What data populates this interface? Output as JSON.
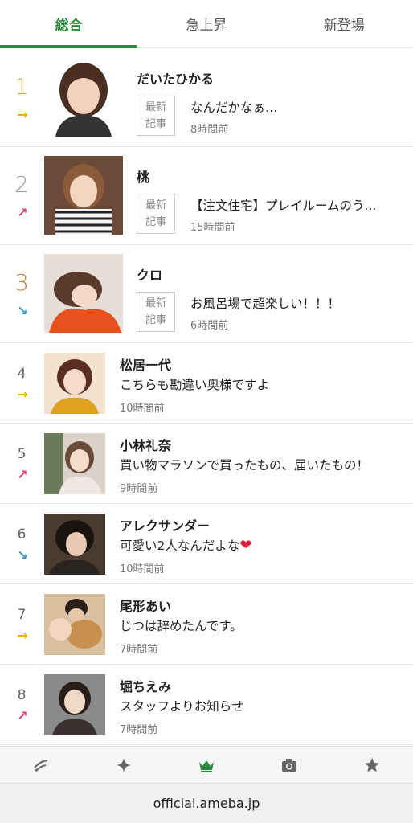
{
  "tabs": [
    {
      "label": "総合",
      "active": true
    },
    {
      "label": "急上昇",
      "active": false
    },
    {
      "label": "新登場",
      "active": false
    }
  ],
  "badge_label": "最新\n記事",
  "ranking": [
    {
      "rank": "1",
      "trend": "flat",
      "name": "だいたひかる",
      "article": "なんだかなぁ…",
      "time": "8時間前"
    },
    {
      "rank": "2",
      "trend": "up",
      "name": "桃",
      "article": "【注文住宅】プレイルームのう...",
      "time": "15時間前"
    },
    {
      "rank": "3",
      "trend": "down",
      "name": "クロ",
      "article": "お風呂場で超楽しい！！！",
      "time": "6時間前"
    },
    {
      "rank": "4",
      "trend": "flat",
      "name": "松居一代",
      "article": "こちらも勘違い奥様ですよ",
      "time": "10時間前"
    },
    {
      "rank": "5",
      "trend": "up",
      "name": "小林礼奈",
      "article": "買い物マラソンで買ったもの、届いたもの！",
      "time": "9時間前"
    },
    {
      "rank": "6",
      "trend": "down",
      "name": "アレクサンダー",
      "article": "可愛い2人なんだよな",
      "article_emoji": "❤",
      "time": "10時間前"
    },
    {
      "rank": "7",
      "trend": "flat",
      "name": "尾形あい",
      "article": "じつは辞めたんです。",
      "time": "7時間前"
    },
    {
      "rank": "8",
      "trend": "up",
      "name": "堀ちえみ",
      "article": "スタッフよりお知らせ",
      "time": "7時間前"
    }
  ],
  "bottom_nav": [
    {
      "icon": "new-entry-icon",
      "active": false
    },
    {
      "icon": "sparkle-icon",
      "active": false
    },
    {
      "icon": "crown-icon",
      "active": true
    },
    {
      "icon": "camera-icon",
      "active": false
    },
    {
      "icon": "star-icon",
      "active": false
    }
  ],
  "colors": {
    "accent": "#2a8a3e",
    "trend_flat": "#e8b400",
    "trend_up": "#e0407a",
    "trend_down": "#3a9ad9"
  },
  "url": "official.ameba.jp"
}
